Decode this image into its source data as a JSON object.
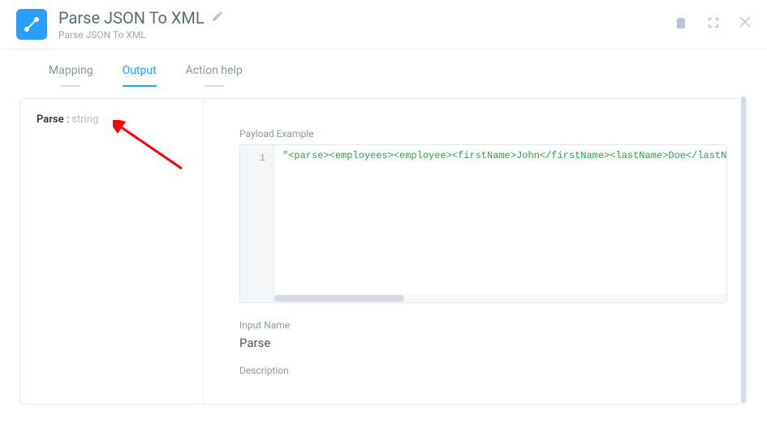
{
  "header": {
    "title": "Parse JSON To XML",
    "subtitle": "Parse JSON To XML"
  },
  "tabs": {
    "mapping": "Mapping",
    "output": "Output",
    "action_help": "Action help"
  },
  "left": {
    "parse_label": "Parse",
    "colon": " : ",
    "parse_type": "string"
  },
  "right": {
    "payload_label": "Payload Example",
    "line_number": "1",
    "code_leading_quote": "\"",
    "code_tags_1": "<parse><employees><employee><firstName>",
    "code_text_1": "John",
    "code_tags_2": "</firstName><lastName>",
    "code_text_2": "Doe",
    "code_tags_3": "</lastName><",
    "input_name_label": "Input Name",
    "input_name_value": "Parse",
    "description_label": "Description"
  }
}
